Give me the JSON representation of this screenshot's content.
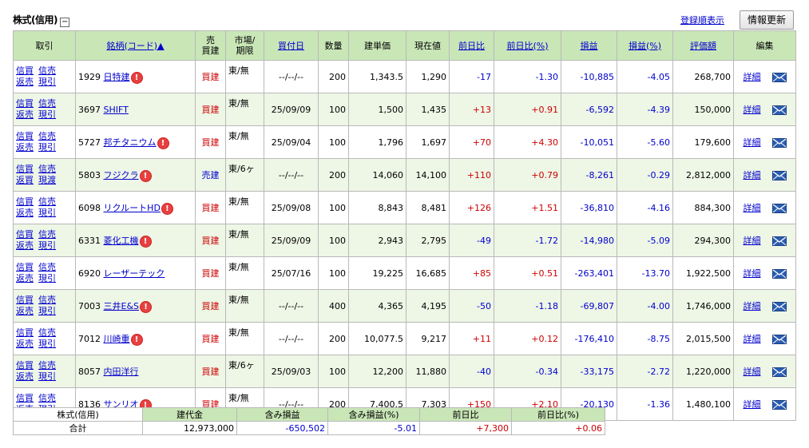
{
  "header": {
    "title": "株式(信用)",
    "collapse_symbol": "−",
    "register_order_link": "登録順表示",
    "update_button": "情報更新"
  },
  "columns": {
    "trade": "取引",
    "name": "銘柄(コード)▲",
    "side": "売\n買建",
    "market": "市場/\n期限",
    "date": "買付日",
    "qty": "数量",
    "buy_price": "建単価",
    "current": "現在値",
    "change": "前日比",
    "change_pct": "前日比(%)",
    "pl": "損益",
    "pl_pct": "損益(%)",
    "value": "評価額",
    "edit": "編集"
  },
  "trade_labels": {
    "credit_buy": "信買",
    "credit_sell": "信売",
    "repay": "返売",
    "current_pull": "現引",
    "current_deliver": "現渡"
  },
  "detail_label": "詳細",
  "rows": [
    {
      "code": "1929",
      "name": "日特建",
      "badge": true,
      "side": "買建",
      "market": "東/無",
      "date": "--/--/--",
      "qty": "200",
      "buy_price": "1,343.5",
      "current": "1,290",
      "change": "-17",
      "change_pct": "-1.30",
      "pl": "-10,885",
      "pl_pct": "-4.05",
      "value": "268,700",
      "second_link": "現引"
    },
    {
      "code": "3697",
      "name": "SHIFT",
      "badge": false,
      "side": "買建",
      "market": "東/無",
      "date": "25/09/09",
      "qty": "100",
      "buy_price": "1,500",
      "current": "1,435",
      "change": "+13",
      "change_pct": "+0.91",
      "pl": "-6,592",
      "pl_pct": "-4.39",
      "value": "150,000",
      "second_link": "現引"
    },
    {
      "code": "5727",
      "name": "邦チタニウム",
      "badge": true,
      "side": "買建",
      "market": "東/無",
      "date": "25/09/04",
      "qty": "100",
      "buy_price": "1,796",
      "current": "1,697",
      "change": "+70",
      "change_pct": "+4.30",
      "pl": "-10,051",
      "pl_pct": "-5.60",
      "value": "179,600",
      "second_link": "現引"
    },
    {
      "code": "5803",
      "name": "フジクラ",
      "badge": true,
      "side": "売建",
      "market": "東/6ヶ",
      "date": "--/--/--",
      "qty": "200",
      "buy_price": "14,060",
      "current": "14,100",
      "change": "+110",
      "change_pct": "+0.79",
      "pl": "-8,261",
      "pl_pct": "-0.29",
      "value": "2,812,000",
      "second_link": "現渡",
      "first_link2": "返買"
    },
    {
      "code": "6098",
      "name": "リクルートHD",
      "badge": true,
      "side": "買建",
      "market": "東/無",
      "date": "25/09/08",
      "qty": "100",
      "buy_price": "8,843",
      "current": "8,481",
      "change": "+126",
      "change_pct": "+1.51",
      "pl": "-36,810",
      "pl_pct": "-4.16",
      "value": "884,300",
      "second_link": "現引"
    },
    {
      "code": "6331",
      "name": "菱化工機",
      "badge": true,
      "side": "買建",
      "market": "東/無",
      "date": "25/09/09",
      "qty": "100",
      "buy_price": "2,943",
      "current": "2,795",
      "change": "-49",
      "change_pct": "-1.72",
      "pl": "-14,980",
      "pl_pct": "-5.09",
      "value": "294,300",
      "second_link": "現引"
    },
    {
      "code": "6920",
      "name": "レーザーテック",
      "badge": false,
      "side": "買建",
      "market": "東/無",
      "date": "25/07/16",
      "qty": "100",
      "buy_price": "19,225",
      "current": "16,685",
      "change": "+85",
      "change_pct": "+0.51",
      "pl": "-263,401",
      "pl_pct": "-13.70",
      "value": "1,922,500",
      "second_link": "現引"
    },
    {
      "code": "7003",
      "name": "三井E&S",
      "badge": true,
      "side": "買建",
      "market": "東/無",
      "date": "--/--/--",
      "qty": "400",
      "buy_price": "4,365",
      "current": "4,195",
      "change": "-50",
      "change_pct": "-1.18",
      "pl": "-69,807",
      "pl_pct": "-4.00",
      "value": "1,746,000",
      "second_link": "現引"
    },
    {
      "code": "7012",
      "name": "川崎重",
      "badge": true,
      "side": "買建",
      "market": "東/無",
      "date": "--/--/--",
      "qty": "200",
      "buy_price": "10,077.5",
      "current": "9,217",
      "change": "+11",
      "change_pct": "+0.12",
      "pl": "-176,410",
      "pl_pct": "-8.75",
      "value": "2,015,500",
      "second_link": "現引"
    },
    {
      "code": "8057",
      "name": "内田洋行",
      "badge": false,
      "side": "買建",
      "market": "東/6ヶ",
      "date": "25/09/03",
      "qty": "100",
      "buy_price": "12,200",
      "current": "11,880",
      "change": "-40",
      "change_pct": "-0.34",
      "pl": "-33,175",
      "pl_pct": "-2.72",
      "value": "1,220,000",
      "second_link": "現引"
    },
    {
      "code": "8136",
      "name": "サンリオ",
      "badge": true,
      "side": "買建",
      "market": "東/無",
      "date": "--/--/--",
      "qty": "200",
      "buy_price": "7,400.5",
      "current": "7,303",
      "change": "+150",
      "change_pct": "+2.10",
      "pl": "-20,130",
      "pl_pct": "-1.36",
      "value": "1,480,100",
      "second_link": "現引"
    }
  ],
  "summary": {
    "label1": "株式(信用)",
    "label2": "合計",
    "headers": [
      "建代金",
      "含み損益",
      "含み損益(%)",
      "前日比",
      "前日比(%)"
    ],
    "values": [
      "12,973,000",
      "-650,502",
      "-5.01",
      "+7,300",
      "+0.06"
    ]
  },
  "colors": {
    "header_bg": "#c9e6b7",
    "alt_row_bg": "#eef6e6",
    "positive": "#cc0000",
    "negative": "#0000cc",
    "link": "#0000cc"
  }
}
